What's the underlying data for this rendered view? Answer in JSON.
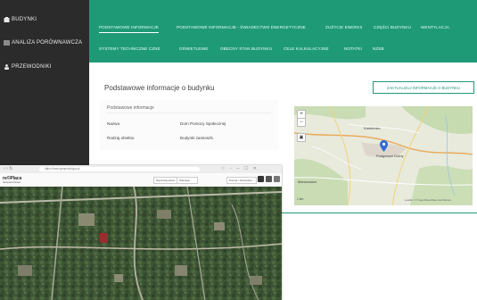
{
  "sidebar": {
    "items": [
      {
        "label": "BUDYNKI",
        "icon": "building-icon"
      },
      {
        "label": "ANALIZA PORÓWNAWCZA",
        "icon": "list-icon"
      },
      {
        "label": "PRZEWODNIKI",
        "icon": "people-icon"
      }
    ]
  },
  "tabs": {
    "row1": [
      "PODSTAWOWE INFORMACJE",
      "PODSTAWOWE INFORMACJE - ŚWIADECTWO ENERGETYCZNE",
      "ZUŻYCIE ENERGII",
      "CZĘŚCI BUDYNKU",
      "WENTYLACJA"
    ],
    "row2": [
      "SYSTEMY TECHNICZNE CZNE",
      "OŚWIETLENIE",
      "OBECNY STAN BUDYNKU",
      "CELE KALKULACYJNE",
      "NOTATKI",
      "NZEB"
    ]
  },
  "main": {
    "title": "Podstawowe informacje o budynku",
    "edit_button": "ZAKTUALIZUJ INFORMACJE O BUDYNKU",
    "card": {
      "subtitle": "Podstawowe informacje",
      "rows": [
        {
          "label": "Nazwa",
          "value": "Dom Pomocy Społecznej"
        },
        {
          "label": "Rodzaj obiektu",
          "value": "Budynki zamieszk."
        }
      ]
    }
  },
  "map": {
    "zoom_in": "+",
    "zoom_out": "−",
    "place_top": "Kamieniec",
    "place_center": "Podgórzyn Dolny",
    "place_bottom": "Marszowice",
    "scale": "1 km",
    "attribution": "Leaflet | © OpenStreetMap contributors"
  },
  "browser": {
    "address": "https://www.geoportal.gov.pl",
    "logo": "re©Place",
    "logo_sub": "Geoportal Viewer",
    "field1": "Wyszukaj adres",
    "field2": "Warstwa",
    "field3": "Pomiar / Narzędzia"
  },
  "colors": {
    "accent": "#1f9a77",
    "sidebar": "#2b2b2b"
  }
}
